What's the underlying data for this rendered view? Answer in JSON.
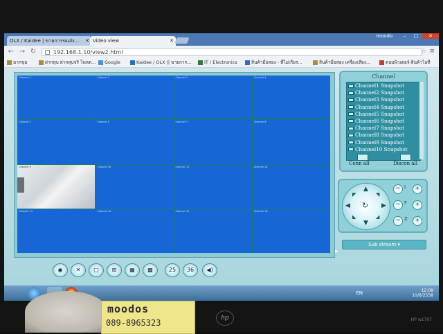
{
  "browser": {
    "tabs": [
      {
        "label": "OLX / Kaidee | ขายการขนส่ง...",
        "active": false
      },
      {
        "label": "Video view",
        "active": true
      }
    ],
    "window_label": "moodo",
    "url": "192.168.1.10/view2.html",
    "bookmarks": [
      {
        "label": "มากขุม"
      },
      {
        "label": "ฝากหุบ ฝากหุบจริ โพลต..."
      },
      {
        "label": "Google"
      },
      {
        "label": "Kaidee / OLX || ขายการ..."
      },
      {
        "label": "IT / Electronics"
      },
      {
        "label": "สินค้ามือสอง - ที่ไม่เกียร..."
      },
      {
        "label": "สินค้ามือสอง เครื่องเสียง..."
      },
      {
        "label": "คอมพิวเตอร์-สินค้าไอที"
      }
    ]
  },
  "video_grid": {
    "cells": [
      {
        "caption": "Channel 1"
      },
      {
        "caption": "Channel 2"
      },
      {
        "caption": "Channel 3"
      },
      {
        "caption": "Channel 4"
      },
      {
        "caption": "Channel 5"
      },
      {
        "caption": "Channel 6"
      },
      {
        "caption": "Channel 7"
      },
      {
        "caption": "Channel 8"
      },
      {
        "caption": "Channel 9"
      },
      {
        "caption": "Channel 10"
      },
      {
        "caption": "Channel 11"
      },
      {
        "caption": "Channel 12"
      },
      {
        "caption": "Channel 13"
      },
      {
        "caption": "Channel 14"
      },
      {
        "caption": "Channel 15"
      },
      {
        "caption": "Channel 16"
      }
    ]
  },
  "channel_panel": {
    "title": "Channel",
    "items": [
      "Channel1 Snapshot",
      "Channel2 Snapshot",
      "Channel3 Snapshot",
      "Channel4 Snapshot",
      "Channel5 Snapshot",
      "Channel6 Snapshot",
      "Channel7 Snapshot",
      "Channel8 Snapshot",
      "Channel9 Snapshot",
      "Channel10 Snapshot"
    ],
    "conn_all": "Conn all",
    "disconn_all": "Discon all"
  },
  "ptz": {
    "zoom_label": "Z",
    "focus_label": "F",
    "iris_label": "I"
  },
  "stream_select": "Sub stream",
  "toolbar": {
    "btn_25": "25",
    "btn_36": "36"
  },
  "taskbar": {
    "lang": "EN",
    "time": "12:08",
    "date": "10/6/2558"
  },
  "sticker": {
    "name": "moodos",
    "phone": "089-8965323"
  },
  "monitor": {
    "brand": "hp",
    "model": "HP w1707"
  }
}
